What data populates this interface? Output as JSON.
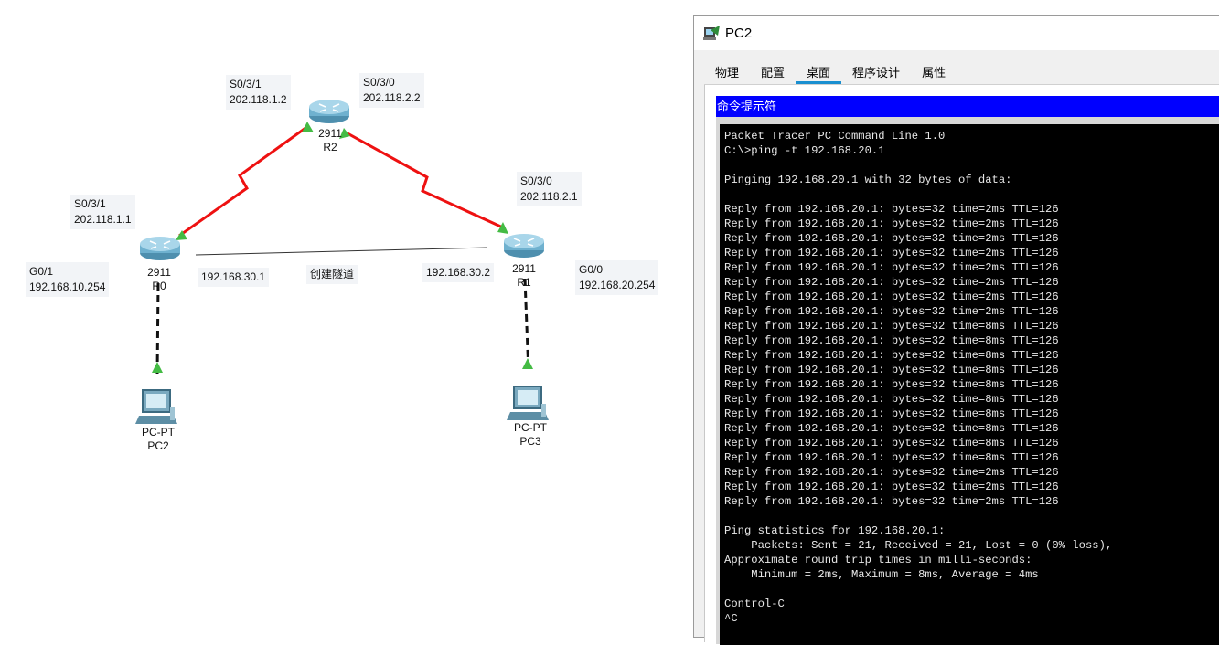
{
  "topology": {
    "labels": {
      "r2_s031": "S0/3/1\n202.118.1.2",
      "r2_s030": "S0/3/0\n202.118.2.2",
      "r0_s031": "S0/3/1\n202.118.1.1",
      "r1_s030": "S0/3/0\n202.118.2.1",
      "r0_g01": "G0/1\n192.168.10.254",
      "r1_g00": "G0/0\n192.168.20.254",
      "tunnel_r0_ip": "192.168.30.1",
      "tunnel_name": "创建隧道",
      "tunnel_r1_ip": "192.168.30.2"
    },
    "devices": {
      "r2": {
        "model": "2911",
        "name": "R2"
      },
      "r0": {
        "model": "2911",
        "name": "R0"
      },
      "r1": {
        "model": "2911",
        "name": "R1"
      },
      "pc2": {
        "model": "PC-PT",
        "name": "PC2"
      },
      "pc3": {
        "model": "PC-PT",
        "name": "PC3"
      }
    },
    "colors": {
      "serial_link": "#ee1111",
      "ethernet_link": "#111111",
      "tunnel_line": "#333333",
      "link_up": "#44bb44"
    }
  },
  "window": {
    "title": "PC2",
    "icon": "packet-tracer-pc-icon",
    "tabs": [
      "物理",
      "配置",
      "桌面",
      "程序设计",
      "属性"
    ],
    "active_tab": "桌面",
    "cmd_title": "命令提示符",
    "console": [
      "Packet Tracer PC Command Line 1.0",
      "C:\\>ping -t 192.168.20.1",
      "",
      "Pinging 192.168.20.1 with 32 bytes of data:",
      "",
      "Reply from 192.168.20.1: bytes=32 time=2ms TTL=126",
      "Reply from 192.168.20.1: bytes=32 time=2ms TTL=126",
      "Reply from 192.168.20.1: bytes=32 time=2ms TTL=126",
      "Reply from 192.168.20.1: bytes=32 time=2ms TTL=126",
      "Reply from 192.168.20.1: bytes=32 time=2ms TTL=126",
      "Reply from 192.168.20.1: bytes=32 time=2ms TTL=126",
      "Reply from 192.168.20.1: bytes=32 time=2ms TTL=126",
      "Reply from 192.168.20.1: bytes=32 time=2ms TTL=126",
      "Reply from 192.168.20.1: bytes=32 time=8ms TTL=126",
      "Reply from 192.168.20.1: bytes=32 time=8ms TTL=126",
      "Reply from 192.168.20.1: bytes=32 time=8ms TTL=126",
      "Reply from 192.168.20.1: bytes=32 time=8ms TTL=126",
      "Reply from 192.168.20.1: bytes=32 time=8ms TTL=126",
      "Reply from 192.168.20.1: bytes=32 time=8ms TTL=126",
      "Reply from 192.168.20.1: bytes=32 time=8ms TTL=126",
      "Reply from 192.168.20.1: bytes=32 time=8ms TTL=126",
      "Reply from 192.168.20.1: bytes=32 time=8ms TTL=126",
      "Reply from 192.168.20.1: bytes=32 time=8ms TTL=126",
      "Reply from 192.168.20.1: bytes=32 time=2ms TTL=126",
      "Reply from 192.168.20.1: bytes=32 time=2ms TTL=126",
      "Reply from 192.168.20.1: bytes=32 time=2ms TTL=126",
      "",
      "Ping statistics for 192.168.20.1:",
      "    Packets: Sent = 21, Received = 21, Lost = 0 (0% loss),",
      "Approximate round trip times in milli-seconds:",
      "    Minimum = 2ms, Maximum = 8ms, Average = 4ms",
      "",
      "Control-C",
      "^C"
    ]
  }
}
